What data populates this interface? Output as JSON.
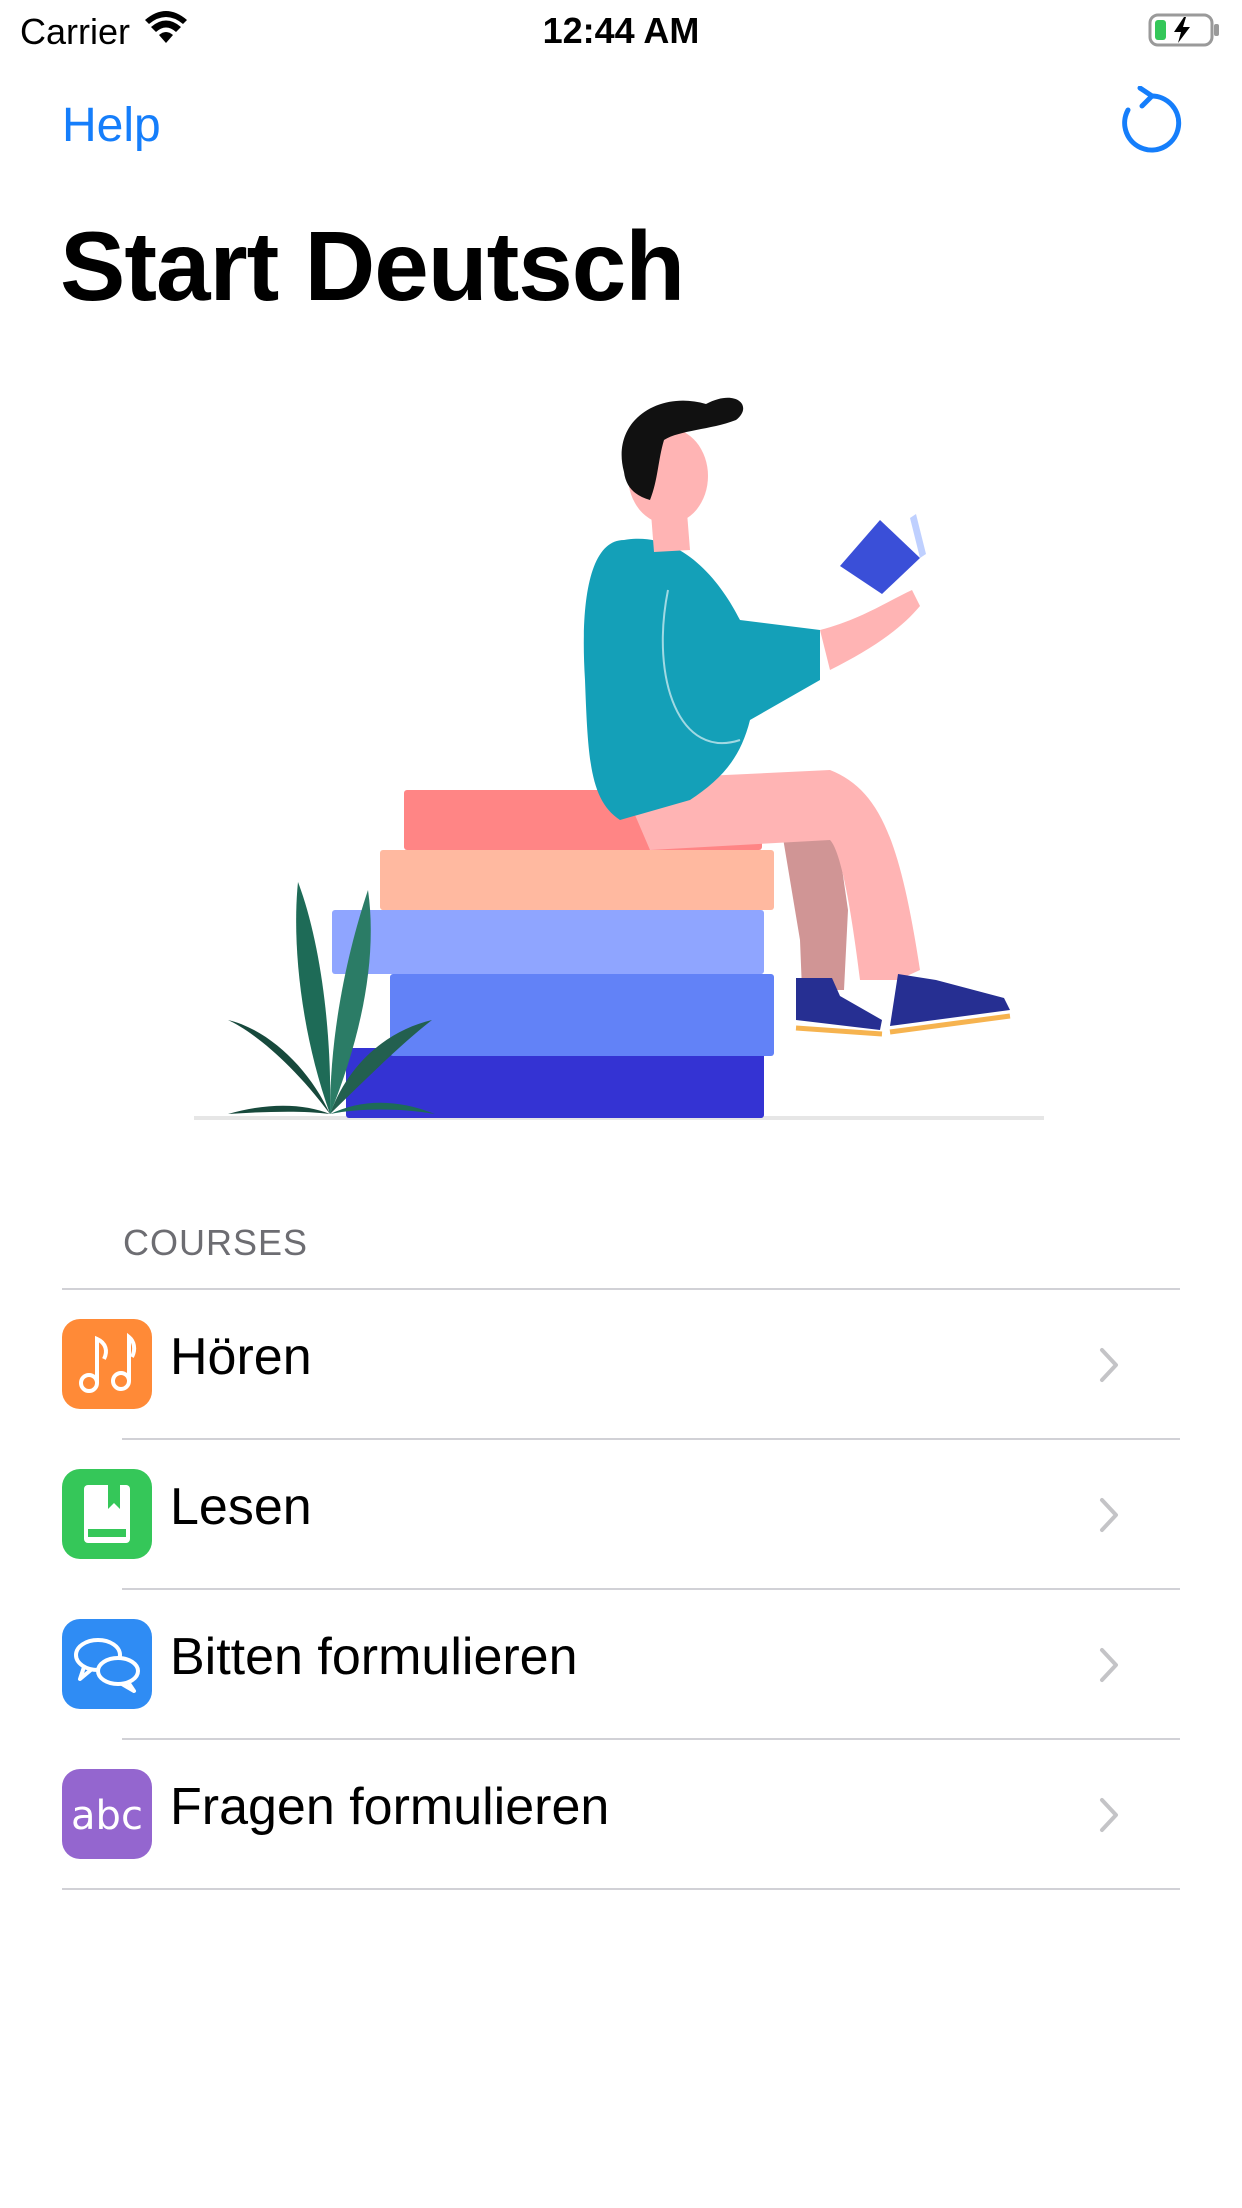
{
  "status_bar": {
    "carrier": "Carrier",
    "time": "12:44 AM"
  },
  "nav": {
    "help_label": "Help"
  },
  "title": "Start Deutsch",
  "courses": {
    "header": "COURSES",
    "items": [
      {
        "label": "Hören",
        "icon": "music-notes-icon",
        "color": "#FF8A37"
      },
      {
        "label": "Lesen",
        "icon": "book-icon",
        "color": "#35C759"
      },
      {
        "label": "Bitten formulieren",
        "icon": "speech-bubbles-icon",
        "color": "#2F8CF4"
      },
      {
        "label": "Fragen formulieren",
        "icon": "abc-text-icon",
        "icon_text": "abc",
        "color": "#9466CF"
      }
    ]
  },
  "colors": {
    "accent": "#157EFB",
    "separator": "#D1D1D6"
  }
}
